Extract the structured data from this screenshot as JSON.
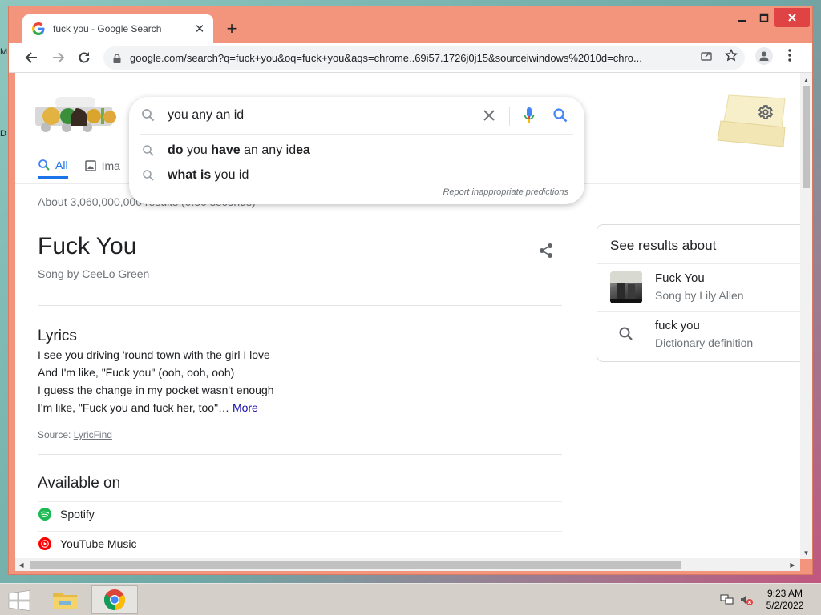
{
  "desktop": {
    "edge_marks": [
      "M",
      "D"
    ]
  },
  "browser": {
    "tab_title": "fuck you - Google Search",
    "new_tab_symbol": "+",
    "url": "google.com/search?q=fuck+you&oq=fuck+you&aqs=chrome..69i57.1726j0j15&sourceiwindows%2010d=chro..."
  },
  "search": {
    "query": "you any an id",
    "suggestions": [
      {
        "parts": [
          {
            "t": "do",
            "b": true
          },
          {
            "t": " you ",
            "b": false
          },
          {
            "t": "have",
            "b": true
          },
          {
            "t": " an any id",
            "b": false
          },
          {
            "t": "ea",
            "b": true
          }
        ]
      },
      {
        "parts": [
          {
            "t": "what is",
            "b": true
          },
          {
            "t": " you id",
            "b": false
          }
        ]
      }
    ],
    "report_text": "Report inappropriate predictions"
  },
  "filters": [
    {
      "label": "All",
      "icon": "magnifier-icon",
      "active": true
    },
    {
      "label": "Ima",
      "icon": "image-icon",
      "active": false
    }
  ],
  "stats": "About 3,060,000,000 results (0.50 seconds)",
  "knowledge_panel": {
    "title": "Fuck You",
    "subtitle": "Song by CeeLo Green",
    "lyrics_heading": "Lyrics",
    "lyrics_lines": [
      "I see you driving 'round town with the girl I love",
      "And I'm like, \"Fuck you\" (ooh, ooh, ooh)",
      "I guess the change in my pocket wasn't enough",
      "I'm like, \"Fuck you and fuck her, too\"…"
    ],
    "more_label": "More",
    "source_label": "Source:",
    "source_link": "LyricFind",
    "available_heading": "Available on",
    "available": [
      {
        "label": "Spotify",
        "icon": "spotify-icon",
        "color": "#1db954"
      },
      {
        "label": "YouTube Music",
        "icon": "youtube-music-icon",
        "color": "#ff0000"
      }
    ]
  },
  "side_panel": {
    "heading": "See results about",
    "items": [
      {
        "title": "Fuck You",
        "subtitle": "Song by Lily Allen"
      },
      {
        "title": "fuck you",
        "subtitle": "Dictionary definition"
      }
    ]
  },
  "taskbar": {
    "time": "9:23 AM",
    "date": "5/2/2022"
  },
  "colors": {
    "window_frame": "#f2957c",
    "google_blue": "#4285f4",
    "link": "#1a0dab",
    "accent_blue": "#1a73e8"
  }
}
